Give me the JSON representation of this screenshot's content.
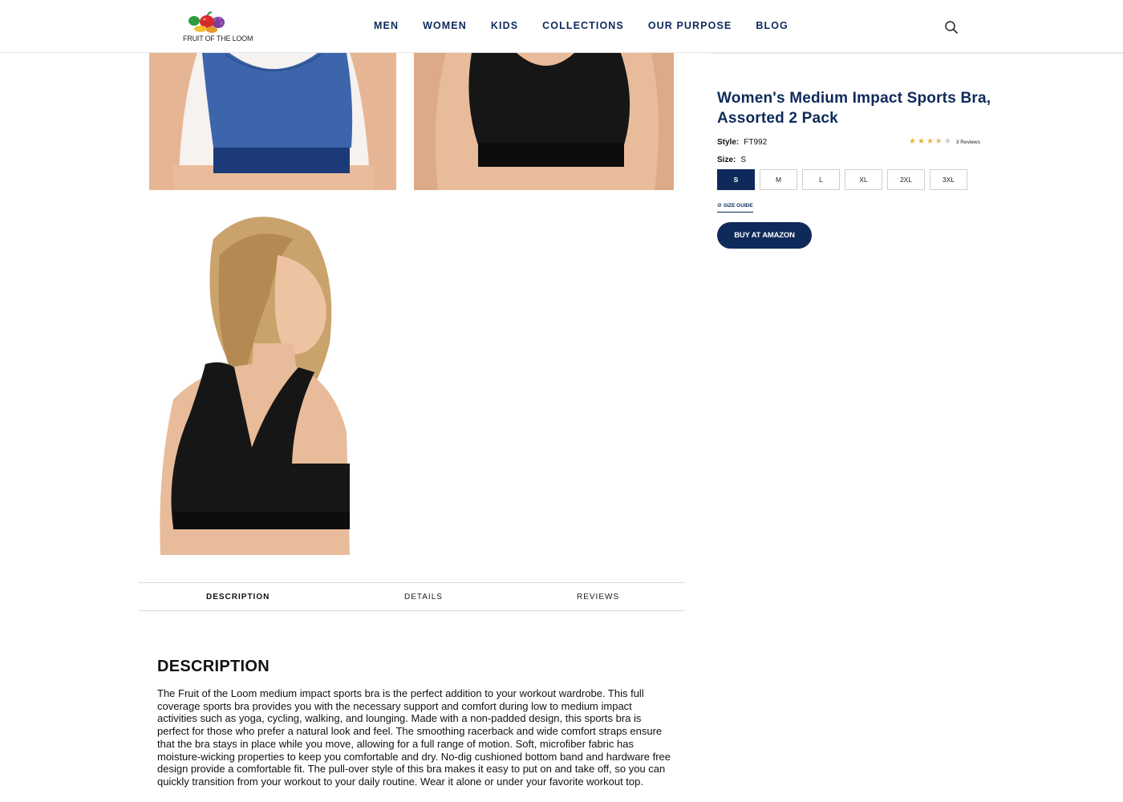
{
  "header": {
    "logo_text": "FRUIT OF THE LOOM",
    "nav": [
      "MEN",
      "WOMEN",
      "KIDS",
      "COLLECTIONS",
      "OUR PURPOSE",
      "BLOG"
    ],
    "search_icon": "search-icon"
  },
  "product": {
    "title": "Women's Medium Impact Sports Bra, Assorted 2 Pack",
    "style_label": "Style:",
    "style_value": "FT992",
    "rating": 3.5,
    "rating_max": 5,
    "reviews_text": "3 Reviews",
    "size_label": "Size:",
    "size_value": "S",
    "sizes": [
      "S",
      "M",
      "L",
      "XL",
      "2XL",
      "3XL"
    ],
    "selected_size": "S",
    "size_guide_label": "SIZE GUIDE",
    "buy_label": "BUY AT AMAZON"
  },
  "tabs": [
    {
      "label": "DESCRIPTION",
      "active": true
    },
    {
      "label": "DETAILS",
      "active": false
    },
    {
      "label": "REVIEWS",
      "active": false
    }
  ],
  "description": {
    "heading": "DESCRIPTION",
    "body": "The Fruit of the Loom medium impact sports bra is the perfect addition to your workout wardrobe. This full coverage sports bra provides you with the necessary support and comfort during low to medium impact activities such as yoga, cycling, walking, and lounging. Made with a non-padded design, this sports bra is perfect for those who prefer a natural look and feel. The smoothing racerback and wide comfort straps ensure that the bra stays in place while you move, allowing for a full range of motion. Soft, microfiber fabric has moisture-wicking properties to keep you comfortable and dry. No-dig cushioned bottom band and hardware free design provide a comfortable fit. The pull-over style of this bra makes it easy to put on and take off, so you can quickly transition from your workout to your daily routine. Wear it alone or under your favorite workout top."
  },
  "colors": {
    "brand_navy": "#0e2a5a",
    "star": "#e8b33c",
    "bra_blue": "#3c65ab",
    "bra_black": "#161616",
    "skin": "#e8bc9a"
  }
}
